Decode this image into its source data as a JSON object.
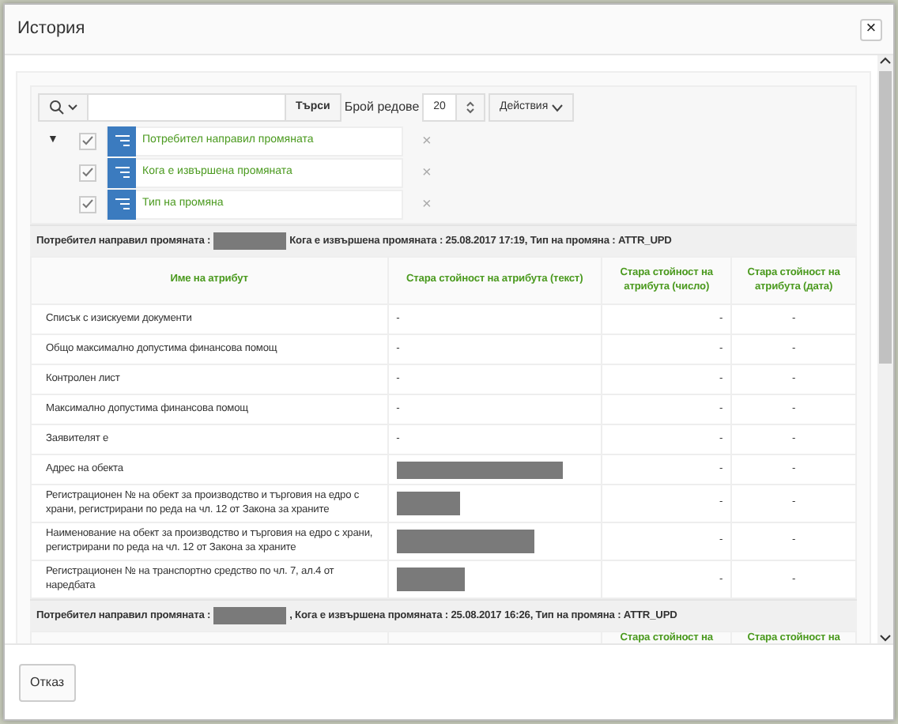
{
  "window": {
    "title": "История",
    "close": "×"
  },
  "toolbar": {
    "search_button": "Търси",
    "rows_label": "Брой редове",
    "rows_value": "20",
    "actions": "Действия"
  },
  "filters": {
    "expanded": true,
    "toggle": "▼",
    "items": [
      {
        "label": "Потребител направил промяната",
        "checked": true,
        "remove": "×"
      },
      {
        "label": "Кога е извършена промяната",
        "checked": true,
        "remove": "×"
      },
      {
        "label": "Тип на промяна",
        "checked": true,
        "remove": "×"
      }
    ]
  },
  "groups": [
    {
      "prefix": "Потребител направил промяната :",
      "suffix": "Кога е извършена промяната : 25.08.2017 17:19, Тип на промяна : ATTR_UPD",
      "columns": [
        "Име на атрибут",
        "Стара стойност на атрибута (текст)",
        "Стара стойност на атрибута (число)",
        "Стара стойност на атрибута (дата)"
      ],
      "rows": [
        [
          {
            "kind": "text",
            "text": "Списък с изискуеми документи"
          },
          {
            "kind": "text",
            "text": "-"
          },
          {
            "kind": "text",
            "text": "-"
          },
          {
            "kind": "text",
            "text": "-"
          }
        ],
        [
          {
            "kind": "text",
            "text": "Общо максимално допустима финансова помощ"
          },
          {
            "kind": "text",
            "text": "-"
          },
          {
            "kind": "text",
            "text": "-"
          },
          {
            "kind": "text",
            "text": "-"
          }
        ],
        [
          {
            "kind": "text",
            "text": "Контролен лист"
          },
          {
            "kind": "text",
            "text": "-"
          },
          {
            "kind": "text",
            "text": "-"
          },
          {
            "kind": "text",
            "text": "-"
          }
        ],
        [
          {
            "kind": "text",
            "text": "Максимално допустима финансова помощ"
          },
          {
            "kind": "text",
            "text": "-"
          },
          {
            "kind": "text",
            "text": "-"
          },
          {
            "kind": "text",
            "text": "-"
          }
        ],
        [
          {
            "kind": "text",
            "text": "Заявителят е"
          },
          {
            "kind": "text",
            "text": "-"
          },
          {
            "kind": "text",
            "text": "-"
          },
          {
            "kind": "text",
            "text": "-"
          }
        ],
        [
          {
            "kind": "text",
            "text": "Адрес на обекта"
          },
          {
            "kind": "redacted"
          },
          {
            "kind": "text",
            "text": "-"
          },
          {
            "kind": "text",
            "text": "-"
          }
        ],
        [
          {
            "kind": "text",
            "text": "Регистрационен № на обект за производство и търговия на едро с храни, регистрирани по реда на чл. 12 от Закона за храните"
          },
          {
            "kind": "redacted"
          },
          {
            "kind": "text",
            "text": "-"
          },
          {
            "kind": "text",
            "text": "-"
          }
        ],
        [
          {
            "kind": "text",
            "text": "Наименование на обект за производство и търговия на едро с храни, регистрирани по реда на чл. 12 от Закона за храните"
          },
          {
            "kind": "redacted"
          },
          {
            "kind": "text",
            "text": "-"
          },
          {
            "kind": "text",
            "text": "-"
          }
        ],
        [
          {
            "kind": "text",
            "text": "Регистрационен № на транспортно средство по чл. 7, ал.4 от наредбата"
          },
          {
            "kind": "redacted"
          },
          {
            "kind": "text",
            "text": "-"
          },
          {
            "kind": "text",
            "text": "-"
          }
        ]
      ]
    },
    {
      "prefix": "Потребител направил промяната :",
      "suffix": ", Кога е извършена промяната : 25.08.2017 16:26, Тип на промяна : ATTR_UPD",
      "columns": [
        null,
        null,
        "Стара стойност на",
        "Стара стойност на"
      ]
    }
  ],
  "footer": {
    "cancel": "Отказ"
  }
}
